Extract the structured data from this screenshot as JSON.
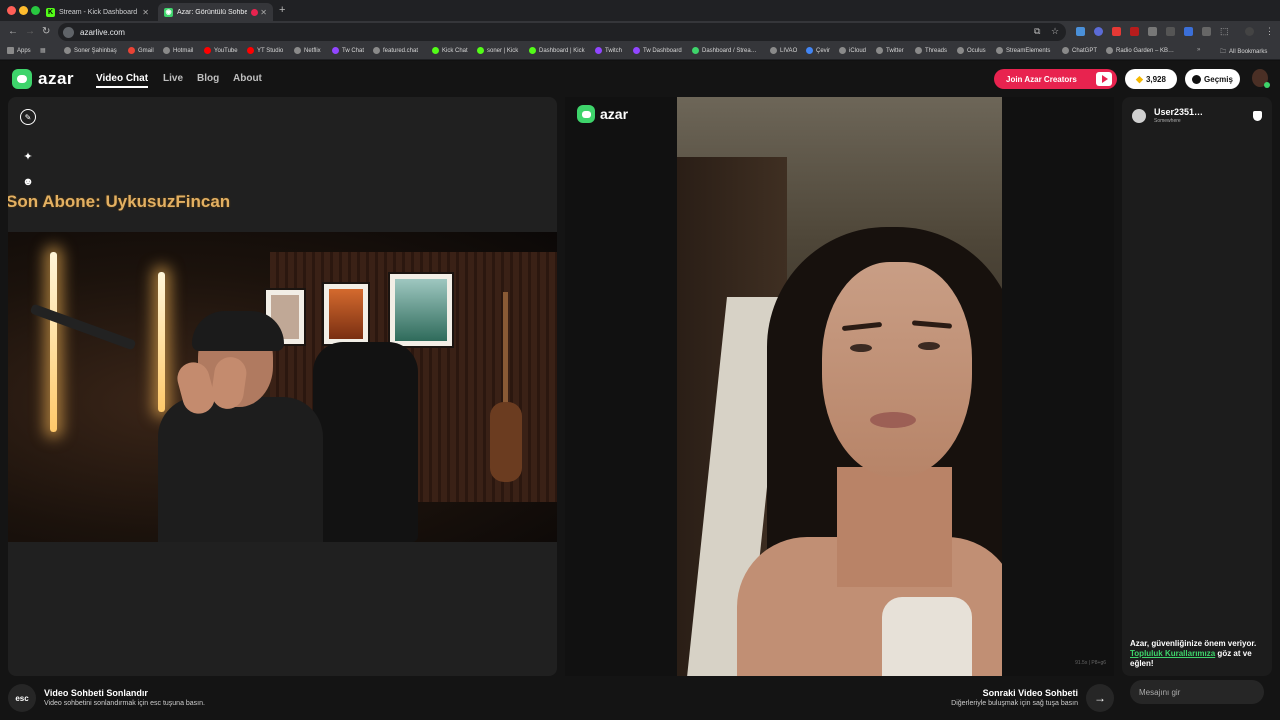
{
  "browser": {
    "tabs": [
      {
        "title": "Stream - Kick Dashboard",
        "icon": "kick-icon",
        "color": "#53fc18"
      },
      {
        "title": "Azar: Görüntülü Sohbet, …",
        "icon": "azar-icon",
        "color": "#3ed46b"
      }
    ],
    "url": "azarlive.com",
    "bookmarks": [
      "Apps",
      "Soner Şahinbaş",
      "Gmail",
      "Hotmail",
      "YouTube",
      "YT Studio",
      "Netflix",
      "Tw Chat",
      "featured.chat",
      "Kick Chat",
      "soner | Kick",
      "Dashboard | Kick",
      "Twitch",
      "Tw Dashboard",
      "Dashboard / Strea…",
      "LIVAO",
      "Çevir",
      "iCloud",
      "Twitter",
      "Threads",
      "Oculus",
      "StreamElements",
      "ChatGPT",
      "Radio Garden – KB…"
    ],
    "all_bookmarks": "All Bookmarks"
  },
  "header": {
    "brand": "azar",
    "nav": [
      "Video Chat",
      "Live",
      "Blog",
      "About"
    ],
    "join_label": "Join Azar Creators",
    "gems": "3,928",
    "history_label": "Geçmiş",
    "colors": {
      "brand": "#3ed46b",
      "join": "#e8234f"
    }
  },
  "left": {
    "overlay_text": "Son Abone: UykusuzFincan",
    "tools": [
      "edit-icon",
      "sparkle-effects-icon",
      "sticker-icon"
    ]
  },
  "partner": {
    "brand": "azar",
    "resolution": "91.5x | P8+g6"
  },
  "chat": {
    "user_name": "User2351…",
    "user_location": "Somewhere",
    "safety_text": "Azar, güvenliğinize önem veriyor.",
    "safety_link": "Topluluk Kurallarımıza",
    "safety_text_2": " göz at ve eğlen!",
    "input_placeholder": "Mesajını gir"
  },
  "bottom": {
    "esc_key": "esc",
    "end_title": "Video Sohbeti Sonlandır",
    "end_hint": "Video sohbetini sonlandırmak için esc tuşuna basın.",
    "next_title": "Sonraki Video Sohbeti",
    "next_hint": "Diğerleriyle buluşmak için sağ tuşa basın"
  }
}
